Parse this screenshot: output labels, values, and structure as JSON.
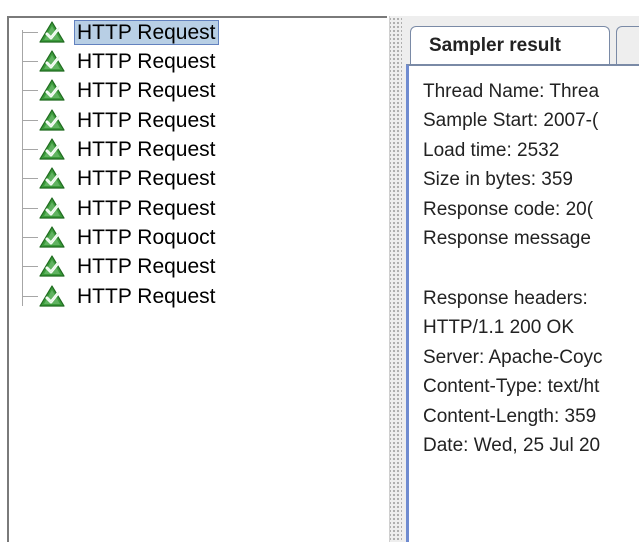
{
  "tree": {
    "items": [
      {
        "label": "HTTP Request",
        "selected": true
      },
      {
        "label": "HTTP Request",
        "selected": false
      },
      {
        "label": "HTTP Request",
        "selected": false
      },
      {
        "label": "HTTP Request",
        "selected": false
      },
      {
        "label": "HTTP Request",
        "selected": false
      },
      {
        "label": "HTTP Request",
        "selected": false
      },
      {
        "label": "HTTP Request",
        "selected": false
      },
      {
        "label": "HTTP Roquoct",
        "selected": false
      },
      {
        "label": "HTTP Request",
        "selected": false
      },
      {
        "label": "HTTP Request",
        "selected": false
      }
    ],
    "icon": "success-triangle-icon",
    "icon_color": "#3a9a3a"
  },
  "result": {
    "tab_label": "Sampler result",
    "lines": [
      "Thread Name: Threa",
      "Sample Start: 2007-(",
      "Load time: 2532",
      "Size in bytes: 359",
      "Response code: 20(",
      "Response message",
      "",
      "Response headers:",
      "HTTP/1.1 200 OK",
      "Server: Apache-Coyc",
      "Content-Type: text/ht",
      "Content-Length: 359",
      "Date: Wed, 25 Jul 20"
    ]
  },
  "colors": {
    "selection": "#b8cfe5",
    "tab_border": "#7a8aa6",
    "content_border": "#6f8bd0"
  }
}
